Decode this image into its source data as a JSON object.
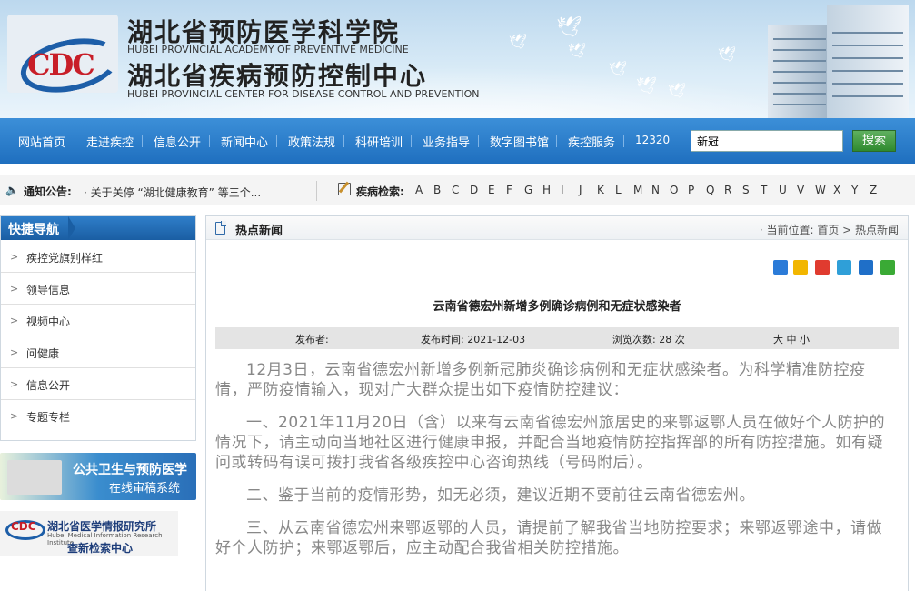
{
  "header": {
    "logo_text": "CDC",
    "title1": "湖北省预防医学科学院",
    "title1_en": "HUBEI PROVINCIAL ACADEMY OF PREVENTIVE MEDICINE",
    "title2": "湖北省疾病预防控制中心",
    "title2_en": "HUBEI PROVINCIAL CENTER FOR DISEASE CONTROL AND PREVENTION"
  },
  "nav": {
    "items": [
      "网站首页",
      "走进疾控",
      "信息公开",
      "新闻中心",
      "政策法规",
      "科研培训",
      "业务指导",
      "数字图书馆",
      "疾控服务",
      "12320"
    ],
    "search_value": "新冠",
    "search_button": "搜索"
  },
  "notice": {
    "label": "通知公告:",
    "text": "· 关于关停 “湖北健康教育” 等三个...",
    "disease_label": "疾病检索:",
    "letters": [
      "A",
      "B",
      "C",
      "D",
      "E",
      "F",
      "G",
      "H",
      "I",
      "J",
      "K",
      "L",
      "M",
      "N",
      "O",
      "P",
      "Q",
      "R",
      "S",
      "T",
      "U",
      "V",
      "W",
      "X",
      "Y",
      "Z"
    ]
  },
  "sidebar": {
    "title": "快捷导航",
    "items": [
      "疾控党旗别样红",
      "领导信息",
      "视频中心",
      "问健康",
      "信息公开",
      "专题专栏"
    ],
    "banner1_line1": "公共卫生与预防医学",
    "banner1_line2": "在线审稿系统",
    "banner2_logo": "CDC",
    "banner2_line1": "湖北省医学情报研究所",
    "banner2_line2": "Hubei Medical Information Research Institute",
    "banner2_line3": "查新检索中心"
  },
  "main": {
    "section_title": "热点新闻",
    "breadcrumb": "· 当前位置: 首页 > 热点新闻",
    "article_title": "云南省德宏州新增多例确诊病例和无症状感染者",
    "meta": {
      "publisher": "发布者:",
      "publish_time": "发布时间: 2021-12-03",
      "views": "浏览次数: 28 次",
      "font_sizes": "大 中 小"
    },
    "paragraphs": [
      "12月3日，云南省德宏州新增多例新冠肺炎确诊病例和无症状感染者。为科学精准防控疫情，严防疫情输入，现对广大群众提出如下疫情防控建议：",
      "一、2021年11月20日（含）以来有云南省德宏州旅居史的来鄂返鄂人员在做好个人防护的情况下，请主动向当地社区进行健康申报，并配合当地疫情防控指挥部的所有防控措施。如有疑问或转码有误可拨打我省各级疾控中心咨询热线（号码附后）。",
      "二、鉴于当前的疫情形势，如无必须，建议近期不要前往云南省德宏州。",
      "三、从云南省德宏州来鄂返鄂的人员，请提前了解我省当地防控要求；来鄂返鄂途中，请做好个人防护；来鄂返鄂后，应主动配合我省相关防控措施。"
    ]
  },
  "colors": {
    "nav_blue": "#2a7ccc",
    "sidebar_title": "#1f68b0",
    "search_green": "#3a963a"
  }
}
